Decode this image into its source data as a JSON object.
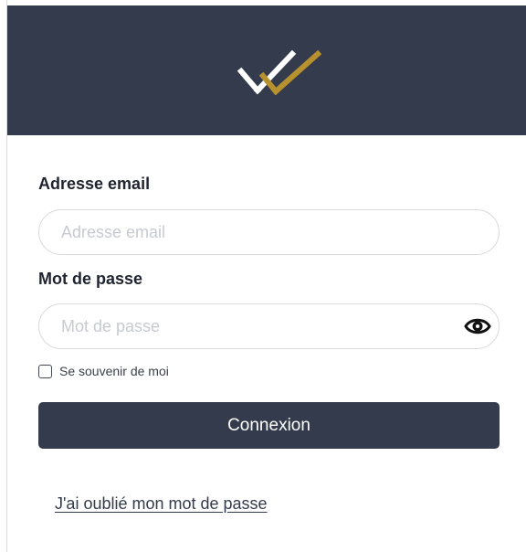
{
  "colors": {
    "header_bg": "#333b4c",
    "logo_gold": "#b8912f",
    "logo_white": "#ffffff",
    "button_bg": "#333b4c",
    "button_text": "#ffffff"
  },
  "header": {
    "logo_icon": "double-checkmark-logo"
  },
  "email": {
    "label": "Adresse email",
    "placeholder": "Adresse email",
    "value": ""
  },
  "password": {
    "label": "Mot de passe",
    "placeholder": "Mot de passe",
    "value": "",
    "toggle_icon": "eye-icon"
  },
  "remember": {
    "label": "Se souvenir de moi",
    "checked": false
  },
  "submit": {
    "label": "Connexion"
  },
  "forgot": {
    "label": "J'ai oublié mon mot de passe"
  }
}
